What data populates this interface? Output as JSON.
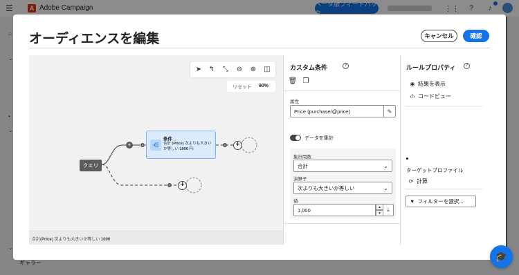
{
  "app": {
    "title": "Adobe Campaign",
    "beta_button": "ベータ版フィードバック",
    "logo_letter": "A",
    "bg_sidebar_label": "ギャラー"
  },
  "modal": {
    "title": "オーディエンスを編集",
    "cancel_label": "キャンセル",
    "confirm_label": "確認"
  },
  "canvas": {
    "zoom_reset_label": "リセット",
    "zoom_value": "90%",
    "query_node_label": "クエリ",
    "condition_node": {
      "title": "条件",
      "desc_prefix": "合計 (",
      "desc_bold": "Price",
      "desc_middle": ") 次よりも大きいか等しい ",
      "desc_value": "1000",
      "desc_suffix": " 円:"
    },
    "footer": {
      "prefix": "合計(",
      "bold": "Price",
      "middle": ") 次よりも大きいか等しい ",
      "value": "1000"
    }
  },
  "custom_condition": {
    "title": "カスタム条件",
    "attribute_label": "属性",
    "attribute_value": "Price (purchase/@price)",
    "toggle_label": "データを集計",
    "agg_function_label": "集計関数",
    "agg_function_value": "合計",
    "operator_label": "演算子",
    "operator_value": "次よりも大きいか等しい",
    "value_label": "値",
    "value_value": "1,000"
  },
  "rule_properties": {
    "title": "ルールプロパティ",
    "show_results": "結果を表示",
    "code_view": "コードビュー",
    "target_profile_label": "ターゲットプロファイル",
    "calculate": "計算",
    "filter_placeholder": "フィルターを選択..."
  },
  "colors": {
    "accent": "#1473e6",
    "node_dark": "#5c5c5c",
    "condition_fill": "#dbeafc"
  }
}
